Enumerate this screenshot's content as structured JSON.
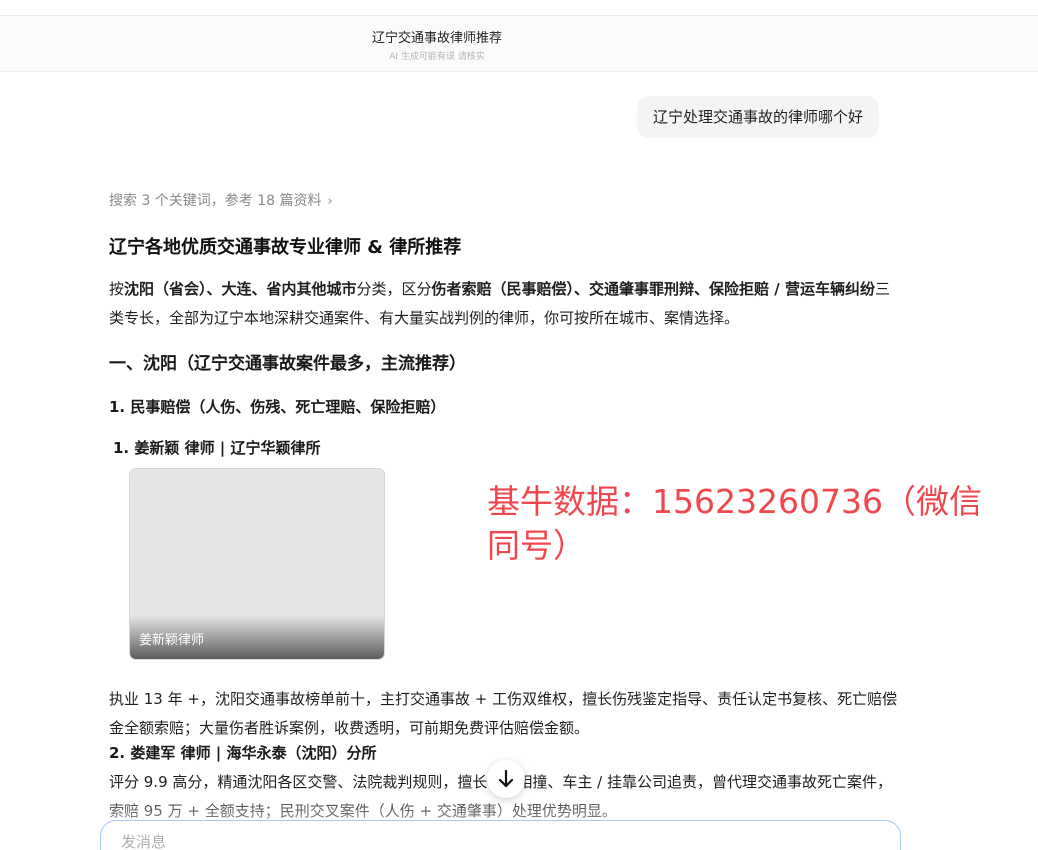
{
  "header": {
    "title": "辽宁交通事故律师推荐",
    "subtitle": "AI 生成可能有误 请核实"
  },
  "user_message": "辽宁处理交通事故的律师哪个好",
  "answer": {
    "search_info": "搜索 3 个关键词，参考 18 篇资料",
    "search_chevron": "›",
    "title": "辽宁各地优质交通事故专业律师 & 律所推荐",
    "intro": {
      "t1": "按",
      "b1": "沈阳（省会）、大连、省内其他城市",
      "t2": "分类，区分",
      "b2": "伤者索赔（民事赔偿）、交通肇事罪刑辩、保险拒赔 / 营运车辆纠纷",
      "t3": "三类专长，全部为辽宁本地深耕交通案件、有大量实战判例的律师，你可按所在城市、案情选择。"
    },
    "section1_heading": "一、沈阳（辽宁交通事故案件最多，主流推荐）",
    "subsection1_heading": "1. 民事赔偿（人伤、伤残、死亡理赔、保险拒赔）",
    "lawyer1": {
      "heading": "1. 姜新颖 律师 | 辽宁华颖律所",
      "photo_caption": "姜新颖律师",
      "description": "执业 13 年 +，沈阳交通事故榜单前十，主打交通事故 + 工伤双维权，擅长伤残鉴定指导、责任认定书复核、死亡赔偿金全额索赔；大量伤者胜诉案例，收费透明，可前期免费评估赔偿金额。"
    },
    "lawyer2": {
      "heading": "2. 娄建军 律师 | 海华永泰（沈阳）分所",
      "description": "评分 9.9 高分，精通沈阳各区交警、法院裁判规则，擅长车辆相撞、车主 / 挂靠公司追责，曾代理交通事故死亡案件，索赔 95 万 + 全额支持；民刑交叉案件（人伤 + 交通肇事）处理优势明显。"
    }
  },
  "watermark": "基牛数据：15623260736（微信同号）",
  "scroll_button_icon": "arrow-down",
  "input": {
    "placeholder": "发消息",
    "focus_border_color": "#a9c8f5"
  },
  "colors": {
    "watermark": "#f0474f",
    "muted_text": "#8a8a8a",
    "bubble_bg": "#f3f4f6"
  }
}
